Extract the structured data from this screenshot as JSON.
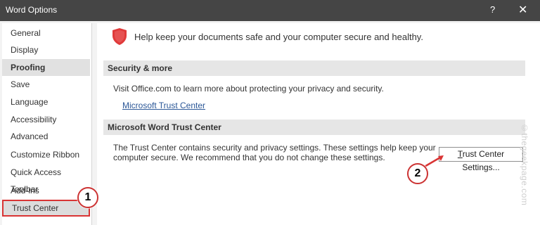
{
  "window": {
    "title": "Word Options",
    "help_glyph": "?",
    "close_glyph": "✕"
  },
  "sidebar": {
    "items": [
      {
        "label": "General"
      },
      {
        "label": "Display"
      },
      {
        "label": "Proofing"
      },
      {
        "label": "Save"
      },
      {
        "label": "Language"
      },
      {
        "label": "Accessibility"
      },
      {
        "label": "Advanced"
      },
      {
        "label": "Customize Ribbon"
      },
      {
        "label": "Quick Access Toolbar"
      },
      {
        "label": "Add-ins"
      },
      {
        "label": "Trust Center"
      }
    ]
  },
  "main": {
    "intro": "Help keep your documents safe and your computer secure and healthy.",
    "security_section": {
      "title": "Security & more",
      "text": "Visit Office.com to learn more about protecting your privacy and security.",
      "link": "Microsoft Trust Center"
    },
    "trust_section": {
      "title": "Microsoft Word Trust Center",
      "text_line1": "The Trust Center contains security and privacy settings. These settings help keep your",
      "text_line2": "computer secure. We recommend that you do not change these settings.",
      "button_underlined": "T",
      "button_rest": "rust Center Settings..."
    }
  },
  "annotations": {
    "step1": "1",
    "step2": "2",
    "watermark": "©thegeekpage.com"
  },
  "colors": {
    "accent_red": "#d93434",
    "shield_red": "#e03a3a",
    "titlebar": "#454545"
  }
}
